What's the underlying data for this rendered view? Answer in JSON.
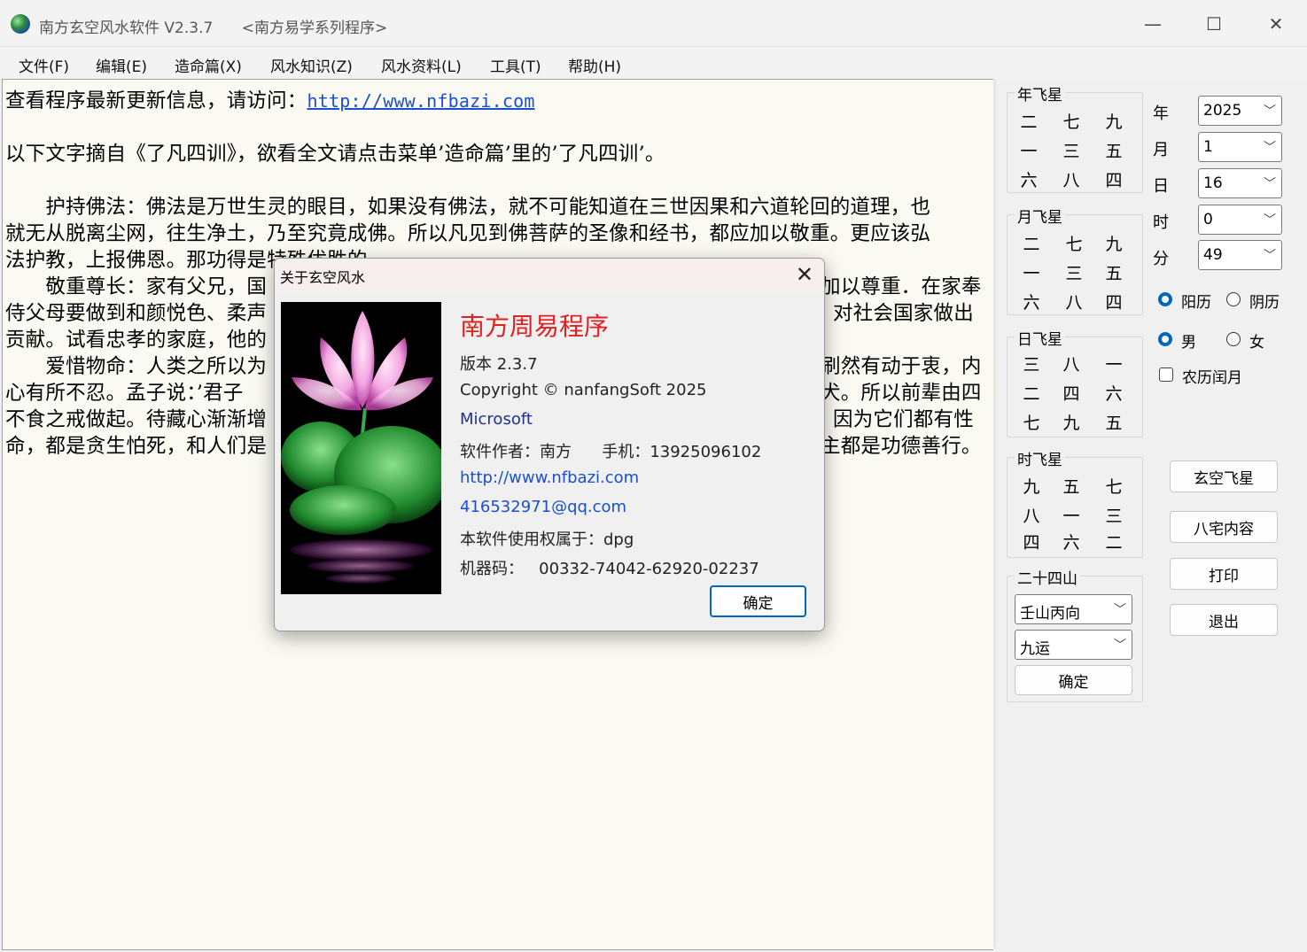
{
  "window": {
    "title": "南方玄空风水软件 V2.3.7      <南方易学系列程序>",
    "minimize": "—",
    "maximize": "☐",
    "close": "✕"
  },
  "menu": [
    "文件(F)",
    "编辑(E)",
    "造命篇(X)",
    "风水知识(Z)",
    "风水资料(L)",
    "工具(T)",
    "帮助(H)"
  ],
  "content": {
    "update_prefix": "查看程序最新更新信息，请访问：",
    "update_url": "http://www.nfbazi.com",
    "intro": "以下文字摘自《了凡四训》，欲看全文请点击菜单’造命篇’里的’了凡四训’。",
    "lines": [
      "　　护持佛法：佛法是万世生灵的眼目，如果没有佛法，就不可能知道在三世因果和六道轮回的道理，也",
      "就无从脱离尘网，往生净土，乃至究竟成佛。所以凡见到佛菩萨的圣像和经书，都应加以敬重。更应该弘",
      "法护教，上报佛恩。那功得是特殊优胜的。",
      "　　敬重尊长：家有父兄，国",
      "侍父母要做到和颜悦色、柔声",
      "贡献。试看忠孝的家庭，他的",
      "　　爱惜物命：人类之所以为",
      "心有所不忍。孟子说：’君子",
      "不食之戒做起。待藏心渐渐增",
      "命，都是贪生怕死，和人们是"
    ],
    "right_lines": [
      "",
      "",
      "",
      "加以尊重．在家奉",
      "对社会国家做出",
      "",
      "刷然有动于衷，内",
      "犬。所以前辈由四",
      "因为它们都有性",
      "主都是功德善行。"
    ]
  },
  "panel": {
    "year_star": {
      "title": "年飞星",
      "grid": [
        [
          "二",
          "七",
          "九"
        ],
        [
          "一",
          "三",
          "五"
        ],
        [
          "六",
          "八",
          "四"
        ]
      ]
    },
    "month_star": {
      "title": "月飞星",
      "grid": [
        [
          "二",
          "七",
          "九"
        ],
        [
          "一",
          "三",
          "五"
        ],
        [
          "六",
          "八",
          "四"
        ]
      ]
    },
    "day_star": {
      "title": "日飞星",
      "grid": [
        [
          "三",
          "八",
          "一"
        ],
        [
          "二",
          "四",
          "六"
        ],
        [
          "七",
          "九",
          "五"
        ]
      ]
    },
    "hour_star": {
      "title": "时飞星",
      "grid": [
        [
          "九",
          "五",
          "七"
        ],
        [
          "八",
          "一",
          "三"
        ],
        [
          "四",
          "六",
          "二"
        ]
      ]
    },
    "fields": [
      {
        "label": "年",
        "value": "2025"
      },
      {
        "label": "月",
        "value": "1"
      },
      {
        "label": "日",
        "value": "16"
      },
      {
        "label": "时",
        "value": "0"
      },
      {
        "label": "分",
        "value": "49"
      }
    ],
    "calendar": {
      "solar": "阳历",
      "lunar": "阴历",
      "selected": "阳历"
    },
    "gender": {
      "male": "男",
      "female": "女",
      "selected": "男"
    },
    "leap_month": {
      "label": "农历闰月",
      "checked": false
    },
    "mountains": {
      "title": "二十四山",
      "mountain": "壬山丙向",
      "period": "九运",
      "confirm": "确定"
    },
    "buttons": {
      "xuankong": "玄空飞星",
      "bazhai": "八宅内容",
      "print": "打印",
      "exit": "退出"
    }
  },
  "dialog": {
    "title": "关于玄空风水",
    "close": "✕",
    "app_name": "南方周易程序",
    "version": "版本 2.3.7",
    "copyright": "Copyright © nanfangSoft 2025",
    "company": "Microsoft",
    "author": "软件作者：南方      手机：13925096102",
    "url": "http://www.nfbazi.com",
    "email": "416532971@qq.com",
    "licensee": "本软件使用权属于：dpg",
    "machine": "机器码：   00332-74042-62920-02237",
    "ok": "确定"
  },
  "colors": {
    "link": "#1a4fd0",
    "app_name": "#e02020",
    "company": "#1e2f8f",
    "accent": "#0067c0"
  }
}
